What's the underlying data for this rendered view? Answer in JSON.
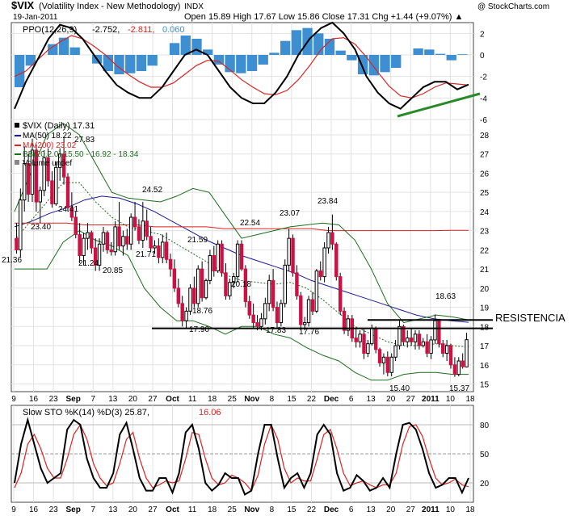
{
  "header": {
    "symbol": "$VIX",
    "name": "(Volatility Index - New Methodology)",
    "exchange": "INDX",
    "date": "19-Jan-2011",
    "watermark": "@ StockCharts.com",
    "ohlc": "Open 15.89  High 17.67  Low 15.86  Close 17.31  Chg +1.44 (+9.07%) ▲"
  },
  "ppo_panel": {
    "legend_label": "PPO(12,26,9)",
    "legend_ppo": "-2.752,",
    "legend_signal": "-2.811,",
    "legend_hist": "0.060",
    "yticks": [
      "2",
      "0",
      "-2",
      "-4",
      "-6"
    ]
  },
  "price_panel": {
    "legend_ticker": "$VIX (Daily) 17.31",
    "legend_ma50": "MA(50) 18.22",
    "legend_ma200": "MA(200) 23.02",
    "legend_bb": "BB(20,2.0) 15.50 - 16.92 - 18.34",
    "legend_volume": "Volume undef",
    "resistance_label": "RESISTENCIA",
    "yticks": [
      "28",
      "27",
      "26",
      "25",
      "24",
      "23",
      "22",
      "21",
      "20",
      "19",
      "18",
      "17",
      "16",
      "15"
    ],
    "annotations": [
      "27.83",
      "24.41",
      "23.40",
      "21.36",
      "21.24",
      "20.85",
      "21.71",
      "24.52",
      "21.59",
      "18.76",
      "17.90",
      "20.18",
      "22.54",
      "17.83",
      "23.07",
      "17.76",
      "23.84",
      "15.40",
      "18.63",
      "15.37"
    ]
  },
  "sto_panel": {
    "legend": "Slow STO %K(14) %D(3) 25.87,",
    "legend_d": "16.06",
    "yticks": [
      "80",
      "50",
      "20"
    ]
  },
  "xaxis": {
    "labels": [
      "9",
      "16",
      "23",
      "Sep",
      "7",
      "13",
      "20",
      "27",
      "Oct",
      "11",
      "18",
      "25",
      "Nov",
      "8",
      "15",
      "22",
      "Dec",
      "6",
      "13",
      "20",
      "27",
      "2011",
      "10",
      "18"
    ]
  },
  "colors": {
    "up": "#ffffff",
    "down": "#cc1144",
    "black": "#000000",
    "ma50": "#1a1a99",
    "ma200": "#dd2222",
    "bb": "#1a6e1a",
    "hist": "#3d8fd1",
    "signal": "#dd2222",
    "trendline": "#2a8a2a"
  },
  "chart_data": [
    {
      "type": "line",
      "title": "PPO(12,26,9)",
      "ylim": [
        -6,
        3
      ],
      "series": [
        {
          "name": "PPO",
          "values": [
            -5,
            -2.5,
            -0.5,
            1.5,
            2.8,
            2.5,
            1.5,
            0,
            -1.5,
            -2.8,
            -3.5,
            -4,
            -4,
            -3,
            -1.5,
            0,
            0.5,
            0,
            -1.5,
            -3,
            -4,
            -4.5,
            -4.5,
            -3.5,
            -2,
            0,
            1.5,
            2.5,
            3,
            2,
            0.5,
            -2,
            -3.5,
            -4.5,
            -5,
            -4,
            -3,
            -2.5,
            -2.5,
            -3.2,
            -2.75
          ]
        },
        {
          "name": "Signal",
          "values": [
            -2,
            -1.5,
            -0.5,
            0.5,
            1.2,
            1.8,
            1.5,
            0.8,
            0,
            -1,
            -1.8,
            -2.5,
            -3,
            -3,
            -2.6,
            -1.8,
            -1,
            -0.5,
            -0.6,
            -1.4,
            -2.3,
            -3,
            -3.6,
            -3.7,
            -3.3,
            -2.3,
            -1,
            0.5,
            1.5,
            1.6,
            1,
            -0.2,
            -1.6,
            -2.9,
            -3.8,
            -4,
            -3.6,
            -3,
            -2.6,
            -2.7,
            -2.8
          ]
        },
        {
          "name": "Histogram",
          "values": [
            -3,
            -1,
            0,
            1,
            1.6,
            0.7,
            0,
            -0.8,
            -1.5,
            -1.8,
            -1.7,
            -1.5,
            -1,
            0,
            1.1,
            1.8,
            1.5,
            0.5,
            -0.9,
            -1.6,
            -1.7,
            -1.5,
            -0.9,
            0.2,
            1.3,
            2.3,
            2.5,
            2,
            1.5,
            0.4,
            -0.5,
            -1.8,
            -1.9,
            -1.6,
            -1.2,
            0,
            0.6,
            0.5,
            0.1,
            -0.5,
            0.06
          ]
        }
      ]
    },
    {
      "type": "candlestick",
      "title": "$VIX (Daily) 17.31",
      "ylim": [
        14.6,
        28.8
      ],
      "candles": [
        [
          22.6,
          23.4,
          21.8,
          22.0
        ],
        [
          22.0,
          25.2,
          21.6,
          24.6
        ],
        [
          24.6,
          27.4,
          24.0,
          26.5
        ],
        [
          26.5,
          27.0,
          24.5,
          24.9
        ],
        [
          24.9,
          27.8,
          24.5,
          27.2
        ],
        [
          27.2,
          27.5,
          24.0,
          24.5
        ],
        [
          24.5,
          25.3,
          23.4,
          25.1
        ],
        [
          25.1,
          27.2,
          24.8,
          26.8
        ],
        [
          26.8,
          27.3,
          25.3,
          25.6
        ],
        [
          25.6,
          26.1,
          24.2,
          24.4
        ],
        [
          24.4,
          26.6,
          24.3,
          26.3
        ],
        [
          26.3,
          27.3,
          25.6,
          27.0
        ],
        [
          27.0,
          27.9,
          25.4,
          25.8
        ],
        [
          25.8,
          26.0,
          24.0,
          24.2
        ],
        [
          24.2,
          25.0,
          23.5,
          23.7
        ],
        [
          23.7,
          24.0,
          22.6,
          22.8
        ],
        [
          22.8,
          23.4,
          21.3,
          21.7
        ],
        [
          21.7,
          22.9,
          21.2,
          22.6
        ],
        [
          22.6,
          23.4,
          22.0,
          22.9
        ],
        [
          22.9,
          23.0,
          21.8,
          22.1
        ],
        [
          22.1,
          22.6,
          20.9,
          21.2
        ],
        [
          21.2,
          22.6,
          20.9,
          22.3
        ],
        [
          22.3,
          23.2,
          21.9,
          22.9
        ],
        [
          22.9,
          23.0,
          21.8,
          22.0
        ],
        [
          22.0,
          22.4,
          21.7,
          21.9
        ],
        [
          21.9,
          23.5,
          21.7,
          23.2
        ],
        [
          23.2,
          24.5,
          22.0,
          22.2
        ],
        [
          22.2,
          23.0,
          21.7,
          22.7
        ],
        [
          22.7,
          23.1,
          22.0,
          22.3
        ],
        [
          22.3,
          23.9,
          22.0,
          23.7
        ],
        [
          23.7,
          24.5,
          23.0,
          23.2
        ],
        [
          23.2,
          23.6,
          22.3,
          22.5
        ],
        [
          22.5,
          24.5,
          22.1,
          23.5
        ],
        [
          23.5,
          24.1,
          22.5,
          22.7
        ],
        [
          22.7,
          23.2,
          21.9,
          22.1
        ],
        [
          22.1,
          22.5,
          21.8,
          22.2
        ],
        [
          22.2,
          22.6,
          21.3,
          21.6
        ],
        [
          21.6,
          22.8,
          21.3,
          22.4
        ],
        [
          22.4,
          22.9,
          21.3,
          21.5
        ],
        [
          21.5,
          21.8,
          20.6,
          21.0
        ],
        [
          21.0,
          21.5,
          19.8,
          20.0
        ],
        [
          20.0,
          20.5,
          19.0,
          19.2
        ],
        [
          19.2,
          19.6,
          18.0,
          18.3
        ],
        [
          18.3,
          19.0,
          17.9,
          18.8
        ],
        [
          18.8,
          20.2,
          18.6,
          20.0
        ],
        [
          20.0,
          20.6,
          19.0,
          19.2
        ],
        [
          19.2,
          21.2,
          19.0,
          21.0
        ],
        [
          21.0,
          21.4,
          19.3,
          19.5
        ],
        [
          19.5,
          20.5,
          19.4,
          20.4
        ],
        [
          20.4,
          22.0,
          20.2,
          21.7
        ],
        [
          21.7,
          22.2,
          20.6,
          20.9
        ],
        [
          20.9,
          22.5,
          20.8,
          22.3
        ],
        [
          22.3,
          22.5,
          20.6,
          20.8
        ],
        [
          20.8,
          21.3,
          19.4,
          19.6
        ],
        [
          19.6,
          20.5,
          19.4,
          20.3
        ],
        [
          20.3,
          20.8,
          20.0,
          20.6
        ],
        [
          20.6,
          22.5,
          20.3,
          22.3
        ],
        [
          22.3,
          22.5,
          20.9,
          21.0
        ],
        [
          21.0,
          21.2,
          19.0,
          19.3
        ],
        [
          19.3,
          19.6,
          18.4,
          18.6
        ],
        [
          18.6,
          19.2,
          17.9,
          18.2
        ],
        [
          18.2,
          18.6,
          17.8,
          18.0
        ],
        [
          18.0,
          18.7,
          17.8,
          18.4
        ],
        [
          18.4,
          19.5,
          18.1,
          19.2
        ],
        [
          19.2,
          20.7,
          18.8,
          20.4
        ],
        [
          20.4,
          21.0,
          18.8,
          19.0
        ],
        [
          19.0,
          19.3,
          17.9,
          18.2
        ],
        [
          18.2,
          19.4,
          18.0,
          19.2
        ],
        [
          19.2,
          21.5,
          19.0,
          21.2
        ],
        [
          21.2,
          23.1,
          20.9,
          22.6
        ],
        [
          22.6,
          22.8,
          20.6,
          20.8
        ],
        [
          20.8,
          21.2,
          19.4,
          19.6
        ],
        [
          19.6,
          19.8,
          17.9,
          18.1
        ],
        [
          18.1,
          18.5,
          17.8,
          18.2
        ],
        [
          18.2,
          19.6,
          18.0,
          19.4
        ],
        [
          19.4,
          19.8,
          18.6,
          18.8
        ],
        [
          18.8,
          21.0,
          18.7,
          20.9
        ],
        [
          20.9,
          21.4,
          20.4,
          20.6
        ],
        [
          20.6,
          22.4,
          20.3,
          22.1
        ],
        [
          22.1,
          23.2,
          21.8,
          22.9
        ],
        [
          22.9,
          23.84,
          22.0,
          22.3
        ],
        [
          22.3,
          22.4,
          20.4,
          20.6
        ],
        [
          20.6,
          20.8,
          18.6,
          18.8
        ],
        [
          18.8,
          19.0,
          17.6,
          17.8
        ],
        [
          17.8,
          18.6,
          17.5,
          18.4
        ],
        [
          18.4,
          18.6,
          17.2,
          17.4
        ],
        [
          17.4,
          17.9,
          16.9,
          17.2
        ],
        [
          17.2,
          17.8,
          16.9,
          17.6
        ],
        [
          17.6,
          17.9,
          16.3,
          16.6
        ],
        [
          16.6,
          17.3,
          16.4,
          17.1
        ],
        [
          17.1,
          18.1,
          17.0,
          17.9
        ],
        [
          17.9,
          18.0,
          16.6,
          16.8
        ],
        [
          16.8,
          16.9,
          15.9,
          16.1
        ],
        [
          16.1,
          16.6,
          15.5,
          16.4
        ],
        [
          16.4,
          16.7,
          15.4,
          15.6
        ],
        [
          15.6,
          16.6,
          15.4,
          16.4
        ],
        [
          16.4,
          17.3,
          16.2,
          17.0
        ],
        [
          17.0,
          18.3,
          16.8,
          18.0
        ],
        [
          18.0,
          18.1,
          17.0,
          17.2
        ],
        [
          17.2,
          17.8,
          16.9,
          17.4
        ],
        [
          17.4,
          17.9,
          17.0,
          17.2
        ],
        [
          17.2,
          17.8,
          16.8,
          17.6
        ],
        [
          17.6,
          17.8,
          16.8,
          17.0
        ],
        [
          17.0,
          17.4,
          16.9,
          17.2
        ],
        [
          17.2,
          17.6,
          16.4,
          16.6
        ],
        [
          16.6,
          17.5,
          16.3,
          17.3
        ],
        [
          17.3,
          18.63,
          17.1,
          18.3
        ],
        [
          18.3,
          18.4,
          16.9,
          17.1
        ],
        [
          17.1,
          17.3,
          16.4,
          16.6
        ],
        [
          16.6,
          17.3,
          16.2,
          17.0
        ],
        [
          17.0,
          17.1,
          15.8,
          16.0
        ],
        [
          16.0,
          16.4,
          15.37,
          15.5
        ],
        [
          15.5,
          16.4,
          15.4,
          16.2
        ],
        [
          16.2,
          16.6,
          15.8,
          15.9
        ],
        [
          15.89,
          17.67,
          15.86,
          17.31
        ]
      ],
      "series": [
        {
          "name": "MA(50)",
          "values": [
            23.2,
            23.5,
            23.9,
            24.2,
            24.6,
            24.8,
            24.7,
            24.4,
            24.0,
            23.5,
            23.0,
            22.5,
            22.1,
            21.7,
            21.4,
            21.1,
            20.8,
            20.4,
            20.1,
            19.8,
            19.5,
            19.2,
            18.9,
            18.6,
            18.4,
            18.3,
            18.22
          ]
        },
        {
          "name": "MA(200)",
          "values": [
            23.4,
            23.4,
            23.4,
            23.4,
            23.3,
            23.3,
            23.3,
            23.3,
            23.2,
            23.2,
            23.2,
            23.2,
            23.1,
            23.1,
            23.1,
            23.1,
            23.1,
            23.1,
            23.0,
            23.0,
            23.0,
            23.0,
            23.0,
            23.0,
            23.0,
            23.02,
            23.02
          ]
        },
        {
          "name": "BB upper",
          "values": [
            24.0,
            26.0,
            28.0,
            28.6,
            28.0,
            26.5,
            25.0,
            24.7,
            24.6,
            24.5,
            24.8,
            25.2,
            25.0,
            23.8,
            22.6,
            22.8,
            23.0,
            23.2,
            23.3,
            23.4,
            23.3,
            22.5,
            21.0,
            19.2,
            18.2,
            18.4,
            18.6,
            18.5,
            18.34
          ]
        },
        {
          "name": "BB middle",
          "values": [
            22.5,
            23.5,
            24.5,
            25.5,
            25.5,
            24.5,
            23.7,
            23.2,
            23.0,
            22.8,
            22.3,
            21.8,
            21.3,
            20.7,
            20.4,
            20.3,
            20.2,
            20.3,
            20.0,
            19.4,
            18.7,
            18.0,
            17.6,
            17.2,
            17.0,
            17.0,
            17.1,
            17.0,
            16.92
          ]
        },
        {
          "name": "BB lower",
          "values": [
            21.0,
            21.0,
            21.0,
            22.4,
            23.0,
            22.5,
            22.2,
            21.7,
            20.0,
            19.0,
            18.3,
            18.3,
            18.0,
            17.6,
            18.0,
            18.0,
            17.6,
            17.4,
            16.9,
            16.5,
            16.2,
            15.6,
            15.2,
            15.2,
            15.5,
            15.6,
            15.6,
            15.5,
            15.5
          ]
        }
      ],
      "resistance_lines": [
        18.34,
        17.9
      ]
    },
    {
      "type": "line",
      "title": "Slow STO %K(14) %D(3) 25.87, 16.06",
      "ylim": [
        0,
        100
      ],
      "series": [
        {
          "name": "%K",
          "values": [
            20,
            60,
            85,
            60,
            35,
            20,
            25,
            30,
            75,
            85,
            80,
            45,
            25,
            15,
            15,
            30,
            70,
            82,
            55,
            25,
            12,
            12,
            25,
            25,
            10,
            30,
            72,
            80,
            55,
            20,
            12,
            18,
            30,
            25,
            25,
            8,
            12,
            50,
            80,
            80,
            45,
            15,
            25,
            30,
            15,
            30,
            70,
            80,
            70,
            30,
            12,
            15,
            28,
            22,
            12,
            15,
            25,
            15,
            50,
            80,
            82,
            75,
            55,
            30,
            15,
            18,
            25,
            25,
            10,
            25
          ]
        },
        {
          "name": "%D",
          "values": [
            15,
            30,
            60,
            70,
            55,
            35,
            25,
            25,
            45,
            70,
            80,
            65,
            40,
            25,
            17,
            20,
            40,
            65,
            72,
            45,
            25,
            15,
            18,
            22,
            20,
            22,
            45,
            72,
            70,
            45,
            25,
            18,
            20,
            28,
            25,
            20,
            12,
            28,
            60,
            80,
            65,
            35,
            20,
            25,
            22,
            22,
            45,
            70,
            75,
            55,
            30,
            17,
            20,
            22,
            18,
            15,
            18,
            18,
            30,
            60,
            78,
            80,
            68,
            45,
            25,
            18,
            20,
            24,
            18,
            16
          ]
        }
      ]
    }
  ]
}
